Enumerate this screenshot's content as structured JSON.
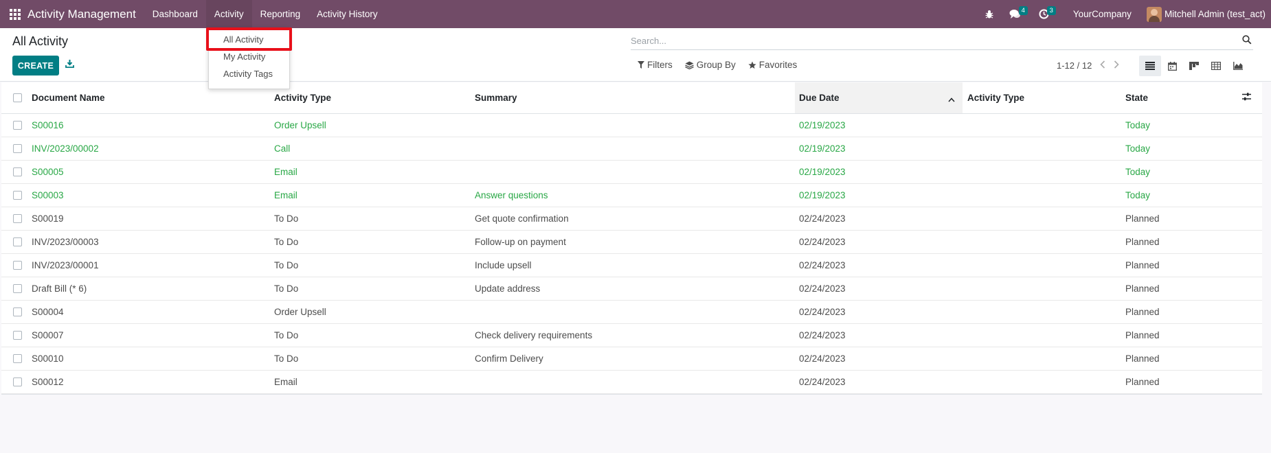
{
  "navbar": {
    "app_title": "Activity Management",
    "menus": [
      {
        "label": "Dashboard"
      },
      {
        "label": "Activity"
      },
      {
        "label": "Reporting"
      },
      {
        "label": "Activity History"
      }
    ],
    "messages_count": "4",
    "activities_count": "3",
    "company": "YourCompany",
    "user": "Mitchell Admin (test_act)"
  },
  "dropdown": {
    "items": [
      {
        "label": "All Activity"
      },
      {
        "label": "My Activity"
      },
      {
        "label": "Activity Tags"
      }
    ]
  },
  "control": {
    "breadcrumb": "All Activity",
    "create_label": "CREATE",
    "search_placeholder": "Search...",
    "filters_label": "Filters",
    "groupby_label": "Group By",
    "favorites_label": "Favorites",
    "pager": "1-12 / 12"
  },
  "table": {
    "headers": {
      "document_name": "Document Name",
      "activity_type": "Activity Type",
      "summary": "Summary",
      "due_date": "Due Date",
      "activity_type_2": "Activity Type",
      "state": "State"
    },
    "rows": [
      {
        "doc": "S00016",
        "type": "Order Upsell",
        "summary": "",
        "due": "02/19/2023",
        "type2": "",
        "state": "Today"
      },
      {
        "doc": "INV/2023/00002",
        "type": "Call",
        "summary": "",
        "due": "02/19/2023",
        "type2": "",
        "state": "Today"
      },
      {
        "doc": "S00005",
        "type": "Email",
        "summary": "",
        "due": "02/19/2023",
        "type2": "",
        "state": "Today"
      },
      {
        "doc": "S00003",
        "type": "Email",
        "summary": "Answer questions",
        "due": "02/19/2023",
        "type2": "",
        "state": "Today"
      },
      {
        "doc": "S00019",
        "type": "To Do",
        "summary": "Get quote confirmation",
        "due": "02/24/2023",
        "type2": "",
        "state": "Planned"
      },
      {
        "doc": "INV/2023/00003",
        "type": "To Do",
        "summary": "Follow-up on payment",
        "due": "02/24/2023",
        "type2": "",
        "state": "Planned"
      },
      {
        "doc": "INV/2023/00001",
        "type": "To Do",
        "summary": "Include upsell",
        "due": "02/24/2023",
        "type2": "",
        "state": "Planned"
      },
      {
        "doc": "Draft Bill (* 6)",
        "type": "To Do",
        "summary": "Update address",
        "due": "02/24/2023",
        "type2": "",
        "state": "Planned"
      },
      {
        "doc": "S00004",
        "type": "Order Upsell",
        "summary": "",
        "due": "02/24/2023",
        "type2": "",
        "state": "Planned"
      },
      {
        "doc": "S00007",
        "type": "To Do",
        "summary": "Check delivery requirements",
        "due": "02/24/2023",
        "type2": "",
        "state": "Planned"
      },
      {
        "doc": "S00010",
        "type": "To Do",
        "summary": "Confirm Delivery",
        "due": "02/24/2023",
        "type2": "",
        "state": "Planned"
      },
      {
        "doc": "S00012",
        "type": "Email",
        "summary": "",
        "due": "02/24/2023",
        "type2": "",
        "state": "Planned"
      }
    ]
  },
  "colors": {
    "navbar": "#714b67",
    "primary": "#017e84",
    "today": "#28a745",
    "highlight": "#e8101a"
  }
}
